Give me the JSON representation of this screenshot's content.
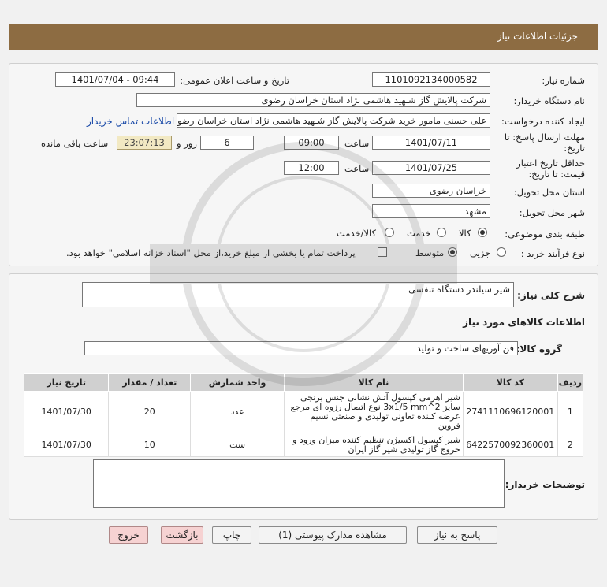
{
  "header": {
    "title": "جزئیات اطلاعات نیاز"
  },
  "form": {
    "need_number_label": "شماره نیاز:",
    "need_number": "1101092134000582",
    "announce_label": "تاریخ و ساعت اعلان عمومی:",
    "announce_value": "1401/07/04 - 09:44",
    "buyer_org_label": "نام دستگاه خریدار:",
    "buyer_org": "شرکت پالایش گاز شـهید هاشمی نژاد   استان خراسان رضوی",
    "requester_label": "ایجاد کننده درخواست:",
    "requester": "علی حسنی مامور خرید شرکت پالایش گاز شـهید هاشمی نژاد   استان خراسان رضوی",
    "contact_link": "اطلاعات تماس خریدار",
    "reply_deadline_label_1": "مهلت ارسال پاسخ: تا",
    "reply_deadline_label_2": "تاریخ:",
    "reply_date": "1401/07/11",
    "time_label": "ساعت",
    "reply_time": "09:00",
    "days": "6",
    "days_label": "روز و",
    "remaining_time": "23:07:13",
    "remaining_label": "ساعت باقی مانده",
    "validity_label_1": "حداقل تاریخ اعتبار",
    "validity_label_2": "قیمت: تا تاریخ:",
    "validity_date": "1401/07/25",
    "validity_time": "12:00",
    "province_label": "استان محل تحویل:",
    "province": "خراسان رضوی",
    "city_label": "شهر محل تحویل:",
    "city": "مشهد",
    "category_label": "طبقه بندی موضوعی:",
    "category_options": [
      "کالا",
      "خدمت",
      "کالا/خدمت"
    ],
    "category_selected": "کالا",
    "process_label": "نوع فرآیند خرید :",
    "process_options": [
      "جزیی",
      "متوسط"
    ],
    "process_selected": "متوسط",
    "payment_note": "پرداخت تمام یا بخشی از مبلغ خرید،از محل \"اسناد خزانه اسلامی\" خواهد بود."
  },
  "details": {
    "summary_label": "شرح کلی نیاز:",
    "summary": "شیر سیلندر دستگاه تنفسی",
    "goods_info_title": "اطلاعات کالاهای مورد نیاز",
    "goods_group_label": "گروه کالا:",
    "goods_group": "فن آوریهای ساخت و تولید",
    "table": {
      "columns": [
        "ردیف",
        "کد کالا",
        "نام کالا",
        "واحد شمارش",
        "تعداد / مقدار",
        "تاریخ نیاز"
      ],
      "rows": [
        {
          "row": "1",
          "code": "2741110696120001",
          "name": "شیر اهرمی کپسول آتش نشانی جنس برنجی سایز 3x1/5 mm^2 نوع اتصال رزوه ای مرجع عرضه کننده تعاونی تولیدی و صنعتی نسیم فزوین",
          "unit": "عدد",
          "qty": "20",
          "date": "1401/07/30"
        },
        {
          "row": "2",
          "code": "6422570092360001",
          "name": "شیر کپسول اکسیژن تنظیم کننده میزان ورود و خروج گاز تولیدی شیر گاز ایران",
          "unit": "ست",
          "qty": "10",
          "date": "1401/07/30"
        }
      ]
    },
    "buyer_notes_label": "توضیحات خریدار:",
    "buyer_notes": ""
  },
  "buttons": {
    "reply": "پاسخ به نیاز",
    "attachments": "مشاهده مدارک پیوستی (1)",
    "print": "چاپ",
    "back": "بازگشت",
    "exit": "خروج"
  }
}
